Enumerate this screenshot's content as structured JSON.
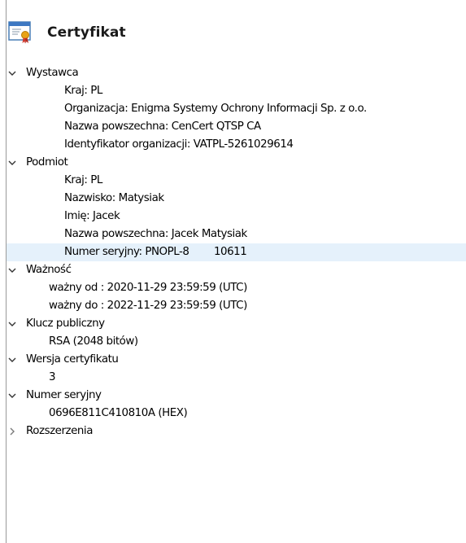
{
  "header": {
    "title": "Certyfikat",
    "icon": "certificate-icon"
  },
  "tree": [
    {
      "label": "Wystawca",
      "expanded": true,
      "children": [
        "Kraj: PL",
        "Organizacja: Enigma Systemy Ochrony Informacji Sp. z o.o.",
        "Nazwa powszechna: CenCert QTSP CA",
        "Identyfikator organizacji: VATPL-5261029614"
      ]
    },
    {
      "label": "Podmiot",
      "expanded": true,
      "children": [
        "Kraj: PL",
        "Nazwisko: Matysiak",
        "Imię: Jacek",
        "Nazwa powszechna: Jacek Matysiak",
        "Numer seryjny: PNOPL-8        10611"
      ]
    },
    {
      "label": "Ważność",
      "expanded": true,
      "children": [
        "ważny od : 2020-11-29 23:59:59 (UTC)",
        "ważny do : 2022-11-29 23:59:59 (UTC)"
      ]
    },
    {
      "label": "Klucz publiczny",
      "expanded": true,
      "children": [
        "RSA (2048 bitów)"
      ]
    },
    {
      "label": "Wersja certyfikatu",
      "expanded": true,
      "children": [
        "3"
      ]
    },
    {
      "label": "Numer seryjny",
      "expanded": true,
      "children": [
        "0696E811C410810A (HEX)"
      ]
    },
    {
      "label": "Rozszerzenia",
      "expanded": false,
      "children": []
    }
  ],
  "selection": {
    "selected_row": "Numer seryjny: PNOPL-8        10611",
    "highlight_color": "#e5f1fb"
  },
  "colors": {
    "chevron_expanded": "#333333",
    "chevron_collapsed": "#7a7a7a"
  }
}
